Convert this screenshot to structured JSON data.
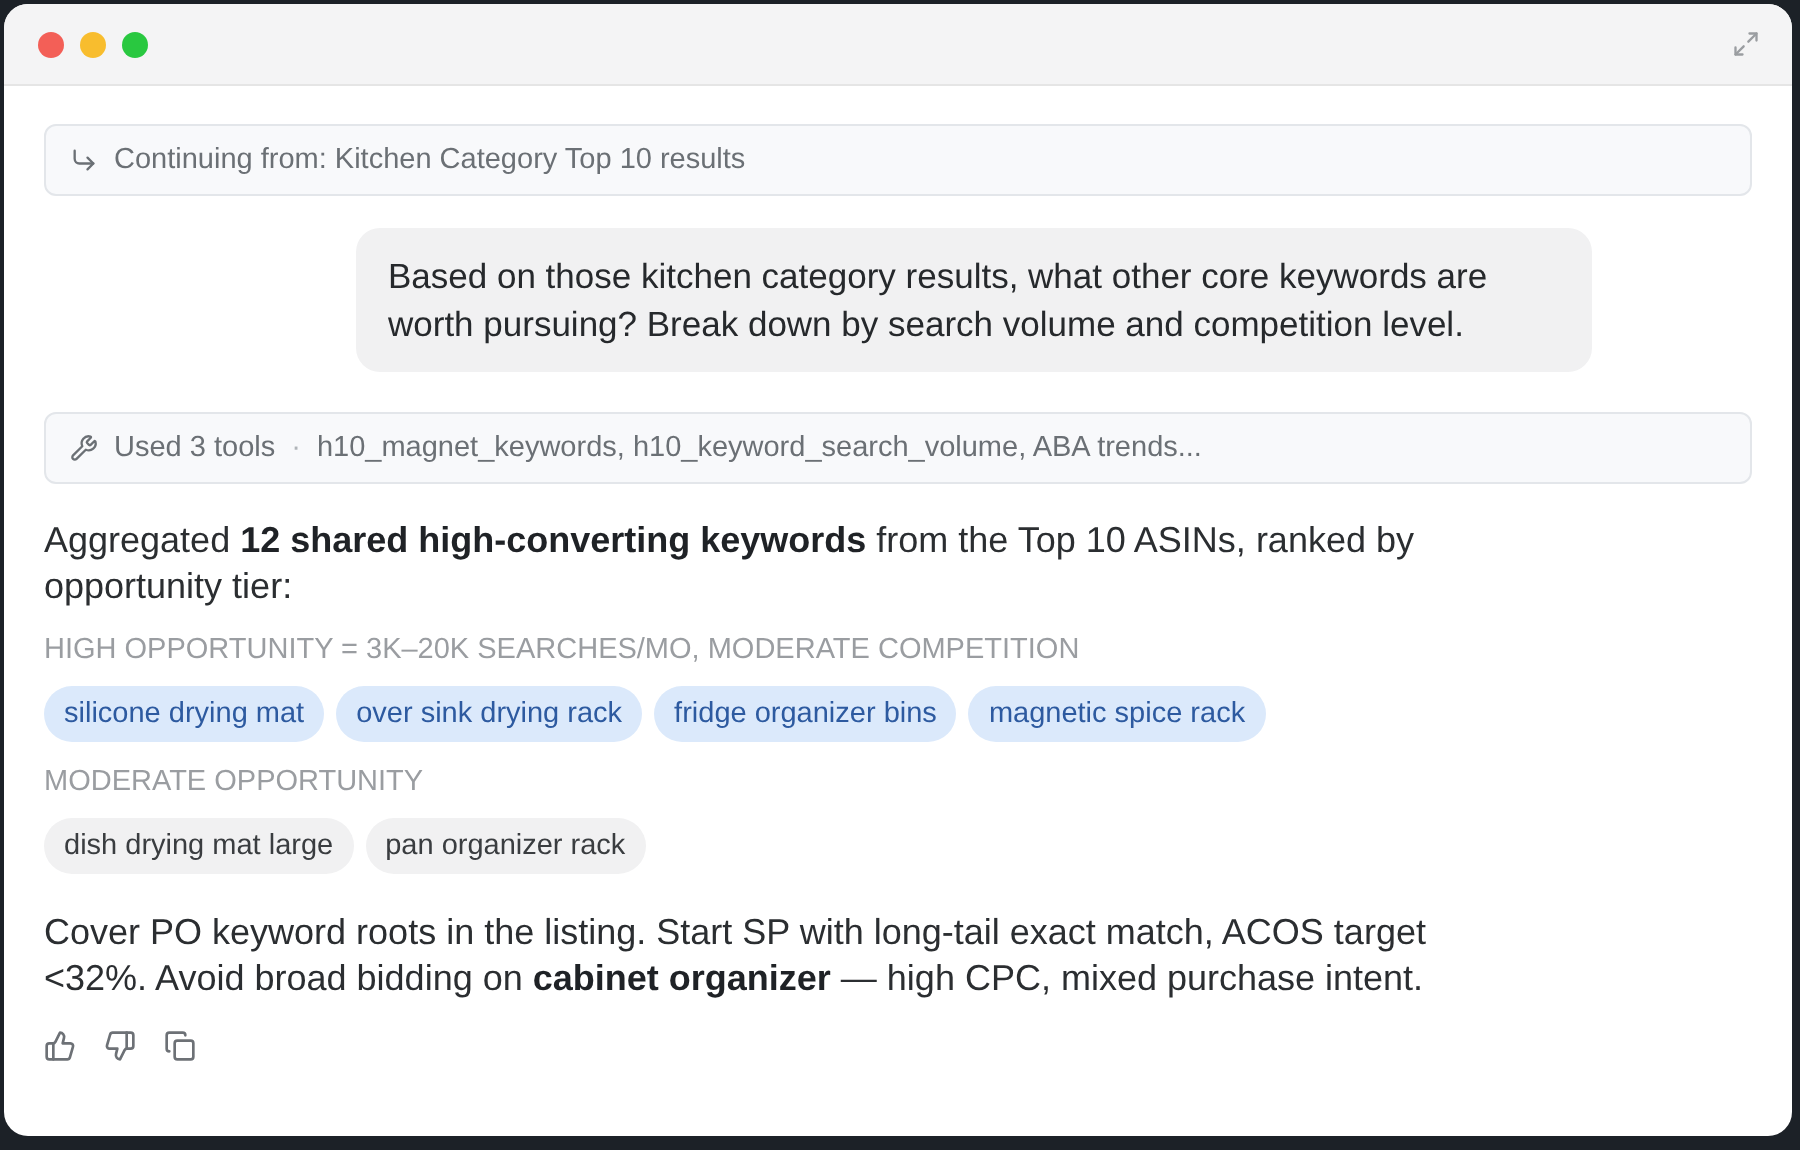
{
  "context": {
    "text": "Continuing from: Kitchen Category Top 10 results"
  },
  "user_message": "Based on those kitchen category results, what other core keywords are worth pursuing? Break down by search volume and competition level.",
  "tools": {
    "label": "Used 3 tools",
    "separator": "·",
    "list": "h10_magnet_keywords, h10_keyword_search_volume, ABA trends..."
  },
  "summary": "Aggregated **12 shared high-converting keywords** from the Top 10 ASINs, ranked by opportunity tier:",
  "tiers": [
    {
      "kind": "high",
      "heading": "HIGH OPPORTUNITY = 3K–20K SEARCHES/MO, MODERATE COMPETITION",
      "keywords": [
        "silicone drying mat",
        "over sink drying rack",
        "fridge organizer bins",
        "magnetic spice rack"
      ]
    },
    {
      "kind": "moderate",
      "heading": "MODERATE OPPORTUNITY",
      "keywords": [
        "dish drying mat large",
        "pan organizer rack"
      ]
    }
  ],
  "advice": "Cover PO keyword roots in the listing. Start SP with long-tail exact match, ACOS target <32%. Avoid broad bidding on **cabinet organizer** — high CPC, mixed purchase intent."
}
